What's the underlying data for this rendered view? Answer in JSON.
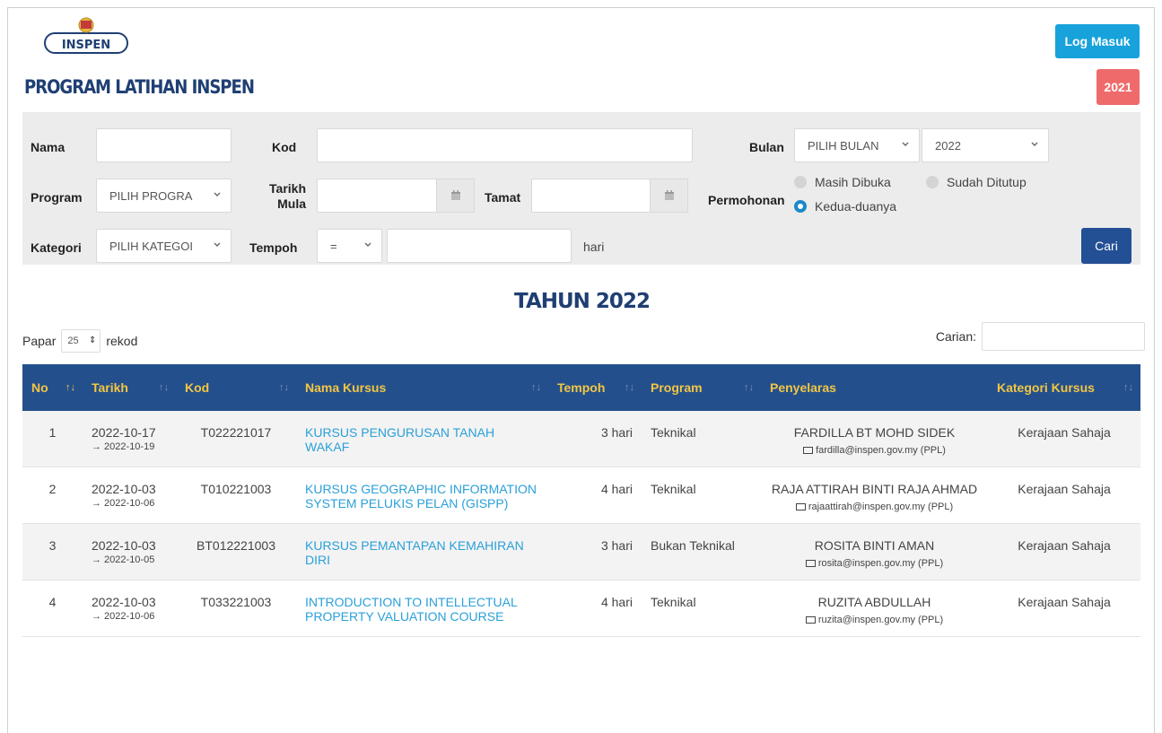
{
  "header": {
    "logo_text": "INSPEN",
    "login_label": "Log Masuk",
    "page_title": "PROGRAM LATIHAN INSPEN",
    "year_badge": "2021"
  },
  "filter": {
    "nama_label": "Nama",
    "kod_label": "Kod",
    "bulan_label": "Bulan",
    "bulan_value": "PILIH BULAN",
    "tahun_value": "2022",
    "program_label": "Program",
    "program_value": "PILIH PROGRA",
    "tarikh_mula_label_1": "Tarikh",
    "tarikh_mula_label_2": "Mula",
    "tamat_label": "Tamat",
    "permohonan_label": "Permohonan",
    "radio_masih": "Masih Dibuka",
    "radio_sudah": "Sudah Ditutup",
    "radio_kedua": "Kedua-duanya",
    "kategori_label": "Kategori",
    "kategori_value": "PILIH KATEGOI",
    "tempoh_label": "Tempoh",
    "tempoh_op": "=",
    "hari_label": "hari",
    "search_label": "Cari"
  },
  "listing": {
    "heading": "TAHUN 2022",
    "papar_label": "Papar",
    "papar_value": "25",
    "rekod_label": "rekod",
    "carian_label": "Carian:"
  },
  "table": {
    "headers": {
      "no": "No",
      "tarikh": "Tarikh",
      "kod": "Kod",
      "nama": "Nama Kursus",
      "tempoh": "Tempoh",
      "program": "Program",
      "penyelaras": "Penyelaras",
      "kategori": "Kategori Kursus"
    },
    "rows": [
      {
        "no": "1",
        "date": "2022-10-17",
        "date_end": "→ 2022-10-19",
        "kod": "T022221017",
        "nama": "KURSUS PENGURUSAN TANAH WAKAF",
        "tempoh": "3 hari",
        "program": "Teknikal",
        "penyelaras": "FARDILLA BT MOHD SIDEK",
        "email": "fardilla@inspen.gov.my (PPL)",
        "kategori": "Kerajaan Sahaja"
      },
      {
        "no": "2",
        "date": "2022-10-03",
        "date_end": "→ 2022-10-06",
        "kod": "T010221003",
        "nama": "KURSUS GEOGRAPHIC INFORMATION SYSTEM PELUKIS PELAN (GISPP)",
        "tempoh": "4 hari",
        "program": "Teknikal",
        "penyelaras": "RAJA ATTIRAH BINTI RAJA AHMAD",
        "email": "rajaattirah@inspen.gov.my (PPL)",
        "kategori": "Kerajaan Sahaja"
      },
      {
        "no": "3",
        "date": "2022-10-03",
        "date_end": "→ 2022-10-05",
        "kod": "BT012221003",
        "nama": "KURSUS PEMANTAPAN KEMAHIRAN DIRI",
        "tempoh": "3 hari",
        "program": "Bukan Teknikal",
        "penyelaras": "ROSITA BINTI AMAN",
        "email": "rosita@inspen.gov.my (PPL)",
        "kategori": "Kerajaan Sahaja"
      },
      {
        "no": "4",
        "date": "2022-10-03",
        "date_end": "→ 2022-10-06",
        "kod": "T033221003",
        "nama": "INTRODUCTION TO INTELLECTUAL PROPERTY VALUATION COURSE",
        "tempoh": "4 hari",
        "program": "Teknikal",
        "penyelaras": "RUZITA ABDULLAH",
        "email": "ruzita@inspen.gov.my (PPL)",
        "kategori": "Kerajaan Sahaja"
      }
    ]
  },
  "colors": {
    "brand_navy": "#1f3f73",
    "login_blue": "#17a2db",
    "badge_red": "#ef6b6b",
    "search_blue": "#234f94",
    "table_header": "#23508d",
    "header_text": "#f4c542",
    "link": "#2aa0d8"
  },
  "icons": {
    "logo": "inspen-logo",
    "calendar": "calendar-icon",
    "email": "envelope-icon",
    "sort": "sort-icon",
    "chevron": "chevron-down-icon"
  }
}
